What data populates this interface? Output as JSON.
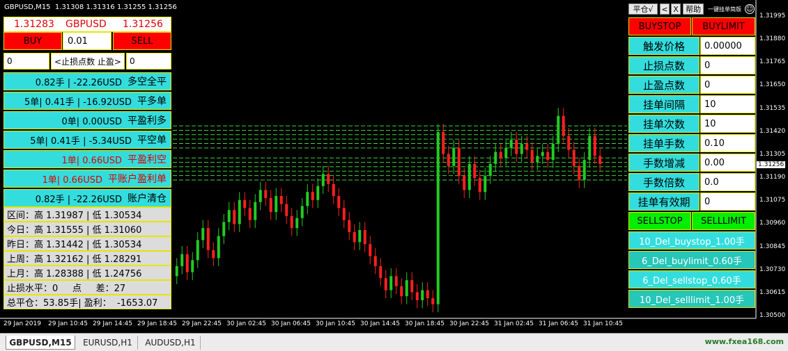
{
  "window": {
    "title": "GBPUSD,M15",
    "ohlc": "1.31308 1.31316 1.31255 1.31256"
  },
  "tabs": [
    {
      "label": "GBPUSD,M15",
      "active": true
    },
    {
      "label": "EURUSD,H1"
    },
    {
      "label": "AUDUSD,H1"
    }
  ],
  "watermark": "www.fxea168.com",
  "left_panel": {
    "bid": "1.31283",
    "symbol": "GBPUSD",
    "ask": "1.31256",
    "buy_label": "BUY",
    "lot_value": "0.01",
    "sell_label": "SELL",
    "sl_value": "0",
    "sl_tp_label": "<止损点数 止盈>",
    "tp_value": "0",
    "actions": [
      {
        "text": "0.82手 | -22.26USD",
        "label": "多空全平",
        "style": "cyan"
      },
      {
        "text": "5单| 0.41手 | -16.92USD",
        "label": "平多单",
        "style": "cyan"
      },
      {
        "text": "0单| 0.00USD",
        "label": "平盈利多",
        "style": "cyan"
      },
      {
        "text": "5单| 0.41手 | -5.34USD",
        "label": "平空单",
        "style": "cyan"
      },
      {
        "text": "1单| 0.66USD",
        "label": "平盈利空",
        "style": "cyan-red"
      },
      {
        "text": "1单| 0.66USD",
        "label": "平账户盈利单",
        "style": "cyan-red"
      },
      {
        "text": "0.82手 | -22.26USD",
        "label": "账户清仓",
        "style": "cyan"
      }
    ],
    "stats": [
      {
        "name": "区间：",
        "value": "高 1.31987 | 低 1.30534"
      },
      {
        "name": "今日：",
        "value": "高 1.31555 | 低 1.31060"
      },
      {
        "name": "昨日：",
        "value": "高 1.31442 | 低 1.30534"
      },
      {
        "name": "上周：",
        "value": "高 1.32162 | 低 1.28291"
      },
      {
        "name": "上月：",
        "value": "高 1.28388 | 低 1.24756"
      },
      {
        "name": "止损水平：",
        "value": "0     点     差：27"
      },
      {
        "name": "总平仓：",
        "value": "53.85手| 盈利：  -1653.07"
      }
    ]
  },
  "right_panel": {
    "toolbar": {
      "pingcang": "平仓√",
      "prev": "<",
      "close": "X",
      "help": "帮助",
      "switch": "一键挂单简版"
    },
    "buystop_label": "BUYSTOP",
    "buylimit_label": "BUYLIMIT",
    "fields": [
      {
        "label": "触发价格",
        "value": "0.00000"
      },
      {
        "label": "止损点数",
        "value": "0"
      },
      {
        "label": "止盈点数",
        "value": "0"
      },
      {
        "label": "挂单间隔",
        "value": "10"
      },
      {
        "label": "挂单次数",
        "value": "10"
      },
      {
        "label": "挂单手数",
        "value": "0.10"
      },
      {
        "label": "手数增减",
        "value": "0.00"
      },
      {
        "label": "手数倍数",
        "value": "0.0"
      },
      {
        "label": "挂单有效期",
        "value": "0"
      }
    ],
    "sellstop_label": "SELLSTOP",
    "selllimit_label": "SELLLIMIT",
    "deletes": [
      "10_Del_buystop_1.00手",
      "6_Del_buylimit_0.60手",
      "6_Del_sellstop_0.60手",
      "10_Del_selllimit_1.00手"
    ]
  },
  "chart_data": {
    "type": "candlestick",
    "symbol": "GBPUSD",
    "timeframe": "M15",
    "price_labels": [
      "1.31995",
      "1.31880",
      "1.31765",
      "1.31650",
      "1.31535",
      "1.31420",
      "1.31305",
      "1.31190",
      "1.31075",
      "1.30960",
      "1.30845",
      "1.30730",
      "1.30615",
      "1.30500"
    ],
    "current_price": "1.31256",
    "time_labels": [
      "29 Jan 2019",
      "29 Jan 10:45",
      "29 Jan 14:45",
      "29 Jan 18:45",
      "29 Jan 22:45",
      "30 Jan 02:45",
      "30 Jan 06:45",
      "30 Jan 10:45",
      "30 Jan 14:45",
      "30 Jan 18:45",
      "30 Jan 22:45",
      "31 Jan 02:45",
      "31 Jan 06:45",
      "31 Jan 10:45"
    ],
    "pending_order_lines": {
      "buy_zone": [
        1.3134,
        1.3145
      ],
      "sell_zone": [
        1.3118,
        1.3129
      ]
    },
    "ylim": [
      1.305,
      1.31995
    ],
    "closes": [
      1.3075,
      1.3081,
      1.3072,
      1.3078,
      1.3088,
      1.3094,
      1.3083,
      1.3079,
      1.309,
      1.3097,
      1.3103,
      1.3096,
      1.3108,
      1.3104,
      1.3098,
      1.3107,
      1.3113,
      1.3109,
      1.3102,
      1.311,
      1.3106,
      1.31,
      1.3094,
      1.3099,
      1.3105,
      1.3112,
      1.3108,
      1.3115,
      1.3121,
      1.3116,
      1.311,
      1.3104,
      1.3098,
      1.3092,
      1.3087,
      1.3093,
      1.3086,
      1.308,
      1.3075,
      1.3069,
      1.3063,
      1.307,
      1.3065,
      1.306,
      1.3068,
      1.3062,
      1.3058,
      1.3063,
      1.3059,
      1.3056,
      1.3142,
      1.3131,
      1.3125,
      1.3134,
      1.312,
      1.3113,
      1.3126,
      1.3119,
      1.3112,
      1.312,
      1.3126,
      1.3132,
      1.3129,
      1.3134,
      1.3138,
      1.3131,
      1.3136,
      1.3133,
      1.3127,
      1.313,
      1.3132,
      1.3128,
      1.3136,
      1.315,
      1.314,
      1.3133,
      1.3125,
      1.3118,
      1.3128,
      1.314,
      1.313,
      1.3126
    ]
  }
}
